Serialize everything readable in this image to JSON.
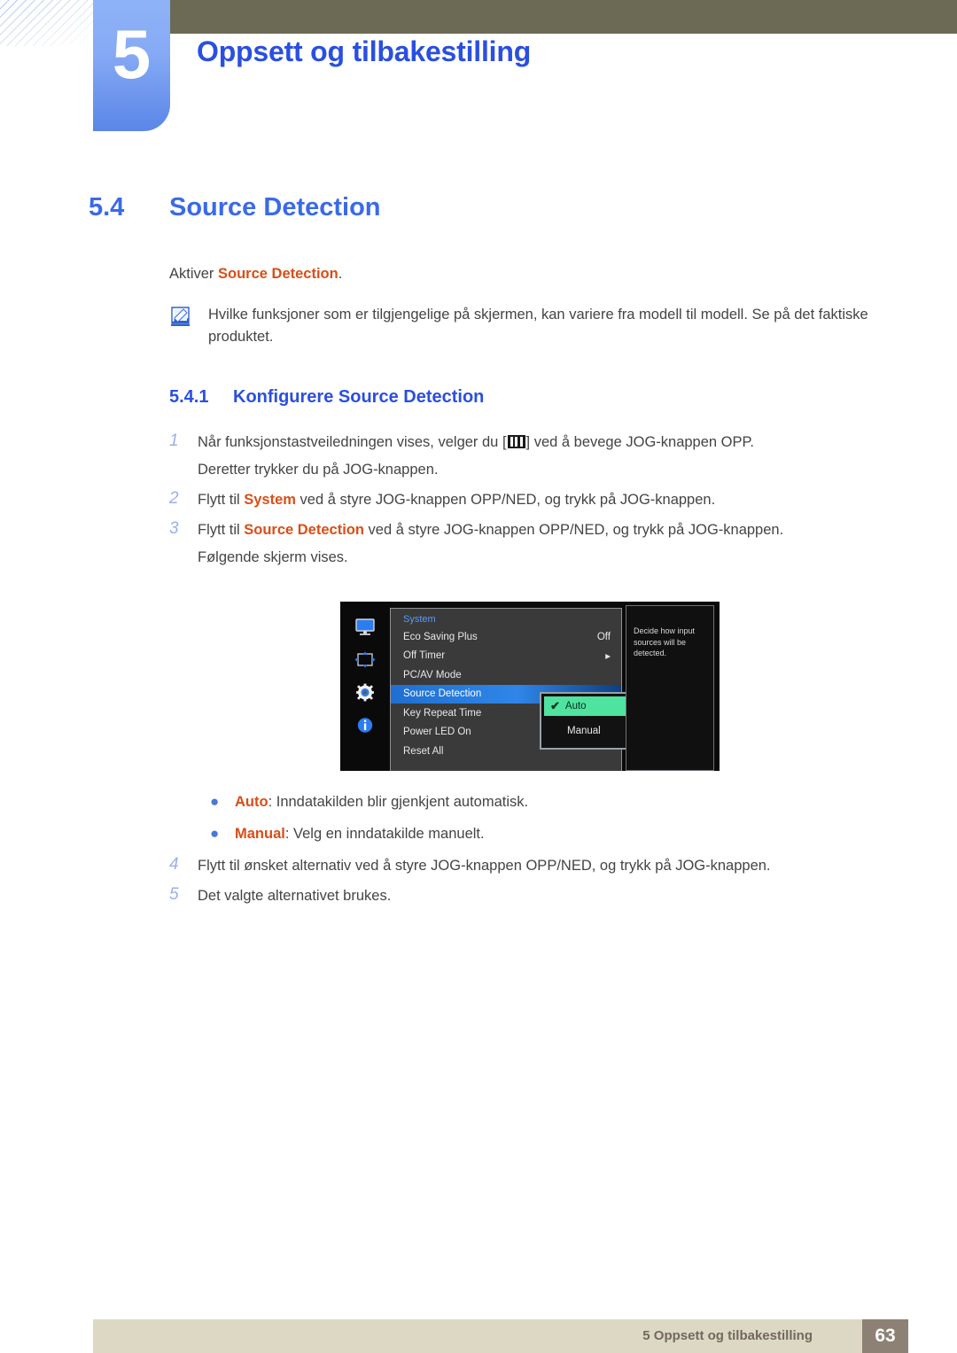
{
  "header": {
    "chapter_number": "5",
    "chapter_title": "Oppsett og tilbakestilling"
  },
  "section": {
    "number": "5.4",
    "title": "Source Detection",
    "intro_prefix": "Aktiver ",
    "intro_highlight": "Source Detection",
    "intro_suffix": "."
  },
  "note": {
    "icon": "note-pencil-icon",
    "text": "Hvilke funksjoner som er tilgjengelige på skjermen, kan variere fra modell til modell. Se på det faktiske produktet."
  },
  "subsection": {
    "number": "5.4.1",
    "title": "Konfigurere Source Detection"
  },
  "steps": [
    {
      "number": "1",
      "text_before": "Når funksjonstastveiledningen vises, velger du [",
      "icon": "jog-menu-icon",
      "text_after": "] ved å bevege JOG-knappen OPP.",
      "continuation": "Deretter trykker du på JOG-knappen."
    },
    {
      "number": "2",
      "text_before": "Flytt til ",
      "highlight": "System",
      "text_after": " ved å styre JOG-knappen OPP/NED, og trykk på JOG-knappen."
    },
    {
      "number": "3",
      "text_before": "Flytt til ",
      "highlight": "Source Detection",
      "text_after": " ved å styre JOG-knappen OPP/NED, og trykk på JOG-knappen.",
      "continuation": "Følgende skjerm vises."
    }
  ],
  "steps_after": [
    {
      "number": "4",
      "text": "Flytt til ønsket alternativ ved å styre JOG-knappen OPP/NED, og trykk på JOG-knappen."
    },
    {
      "number": "5",
      "text": "Det valgte alternativet brukes."
    }
  ],
  "osd": {
    "rail_icons": [
      "monitor-icon",
      "move-arrows-icon",
      "gear-icon",
      "info-icon"
    ],
    "menu_title": "System",
    "rows": [
      {
        "label": "Eco Saving Plus",
        "value": "Off",
        "selected": false
      },
      {
        "label": "Off Timer",
        "value": "▸",
        "selected": false
      },
      {
        "label": "PC/AV Mode",
        "value": "",
        "selected": false
      },
      {
        "label": "Source Detection",
        "value": "",
        "selected": true
      },
      {
        "label": "Key Repeat Time",
        "value": "",
        "selected": false
      },
      {
        "label": "Power LED On",
        "value": "",
        "selected": false
      },
      {
        "label": "Reset All",
        "value": "",
        "selected": false
      }
    ],
    "popup": {
      "selected_item": "Auto",
      "other_item": "Manual",
      "check_glyph": "✔"
    },
    "description": "Decide how input sources will be detected.",
    "colors": {
      "highlight_blue": "#2f86e8",
      "selected_green": "#4fe3a0",
      "title_blue": "#5b9bf3"
    }
  },
  "bullets": [
    {
      "marker": "●",
      "highlight": "Auto",
      "text": ": Inndatakilden blir gjenkjent automatisk."
    },
    {
      "marker": "●",
      "highlight": "Manual",
      "text": ": Velg en inndatakilde manuelt."
    }
  ],
  "footer": {
    "text": "5 Oppsett og tilbakestilling",
    "page_number": "63"
  },
  "colors": {
    "accent_blue": "#2a4fe0",
    "section_blue": "#3a6ae8",
    "highlight_orange": "#d94e17",
    "header_olive": "#6c6a55",
    "footer_beige": "#ddd8c4",
    "footer_brown": "#8d8175"
  }
}
